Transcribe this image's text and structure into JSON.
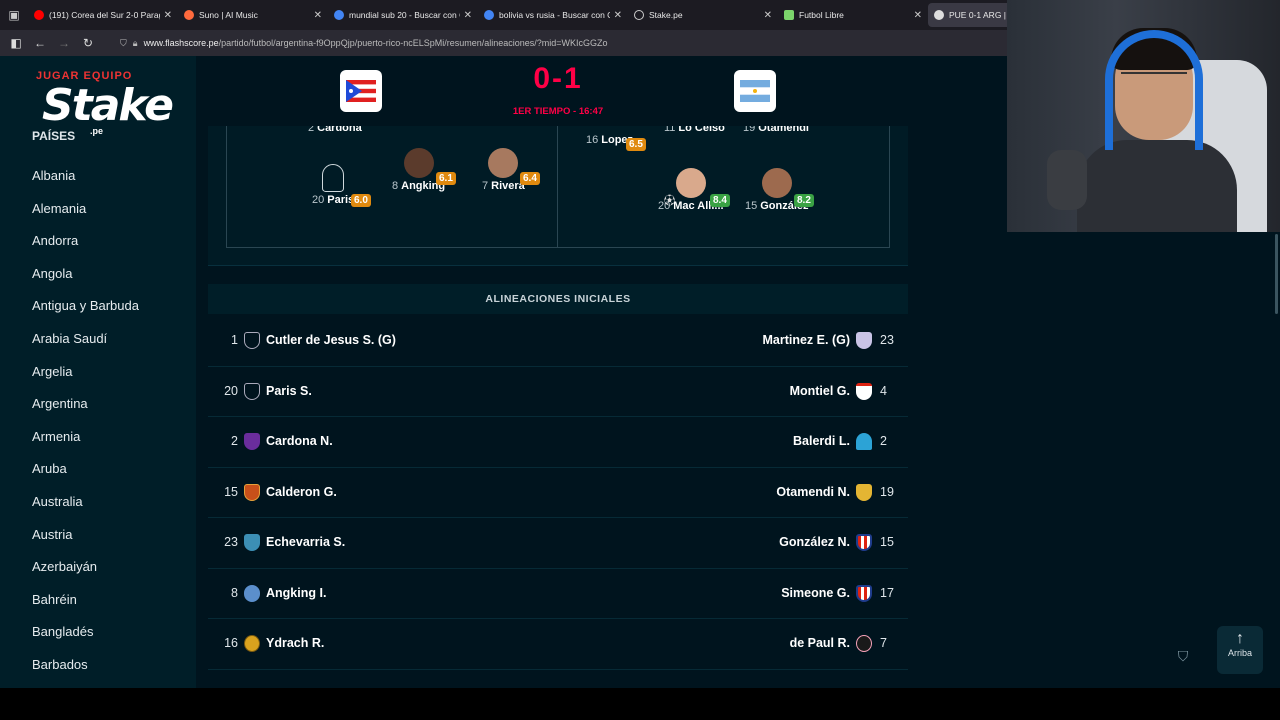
{
  "browser": {
    "tabs": [
      {
        "title": "(191) Corea del Sur 2-0 Paragua",
        "color": "#ff0000"
      },
      {
        "title": "Suno | AI Music",
        "color": "#ff6a3d"
      },
      {
        "title": "mundial sub 20 - Buscar con Go",
        "color": "#4285f4"
      },
      {
        "title": "bolivia vs rusia - Buscar con Go",
        "color": "#4285f4"
      },
      {
        "title": "Stake.pe",
        "color": "#ffffff"
      },
      {
        "title": "Futbol Libre",
        "color": "#7bd46b"
      },
      {
        "title": "PUE 0-1 ARG | P",
        "color": "#ffffff"
      }
    ],
    "url_host": "www.flashscore.pe",
    "url_path": "/partido/futbol/argentina-f9OppQjp/puerto-rico-ncELSpMi/resumen/alineaciones/?mid=WKIcGGZo"
  },
  "sidebar": {
    "logo_top": "JUGAR EQUIPO",
    "logo_word": "Stake",
    "logo_pe": ".pe",
    "heading": "PAÍSES",
    "countries": [
      "Albania",
      "Alemania",
      "Andorra",
      "Angola",
      "Antigua y Barbuda",
      "Arabia Saudí",
      "Argelia",
      "Argentina",
      "Armenia",
      "Aruba",
      "Australia",
      "Austria",
      "Azerbaiyán",
      "Bahréin",
      "Bangladés",
      "Barbados"
    ]
  },
  "match": {
    "score": "0-1",
    "period": "1ER TIEMPO - 16:47"
  },
  "pitch": {
    "players": [
      {
        "num": "2",
        "name": "Cardona"
      },
      {
        "num": "20",
        "name": "Paris",
        "rating": "6.0"
      },
      {
        "num": "8",
        "name": "Angking",
        "rating": "6.1"
      },
      {
        "num": "7",
        "name": "Rivera",
        "rating": "6.4"
      },
      {
        "num": "16",
        "name": "Lopez",
        "rating": "6.5"
      },
      {
        "num": "11",
        "name": "Lo Celso"
      },
      {
        "num": "19",
        "name": "Otamendi"
      },
      {
        "num": "20",
        "name": "Mac Alli...",
        "rating": "8.4"
      },
      {
        "num": "15",
        "name": "González",
        "rating": "8.2"
      }
    ]
  },
  "lineups": {
    "title": "ALINEACIONES INICIALES",
    "rows": [
      {
        "lnum": "1",
        "lname": "Cutler de Jesus S. (G)",
        "rname": "Martinez E. (G)",
        "rnum": "23"
      },
      {
        "lnum": "20",
        "lname": "Paris S.",
        "rname": "Montiel G.",
        "rnum": "4"
      },
      {
        "lnum": "2",
        "lname": "Cardona N.",
        "rname": "Balerdi L.",
        "rnum": "2"
      },
      {
        "lnum": "15",
        "lname": "Calderon G.",
        "rname": "Otamendi N.",
        "rnum": "19"
      },
      {
        "lnum": "23",
        "lname": "Echevarria S.",
        "rname": "González N.",
        "rnum": "15"
      },
      {
        "lnum": "8",
        "lname": "Angking I.",
        "rname": "Simeone G.",
        "rnum": "17"
      },
      {
        "lnum": "16",
        "lname": "Ydrach R.",
        "rname": "de Paul R.",
        "rnum": "7"
      }
    ]
  },
  "scroll_top_label": "Arriba"
}
